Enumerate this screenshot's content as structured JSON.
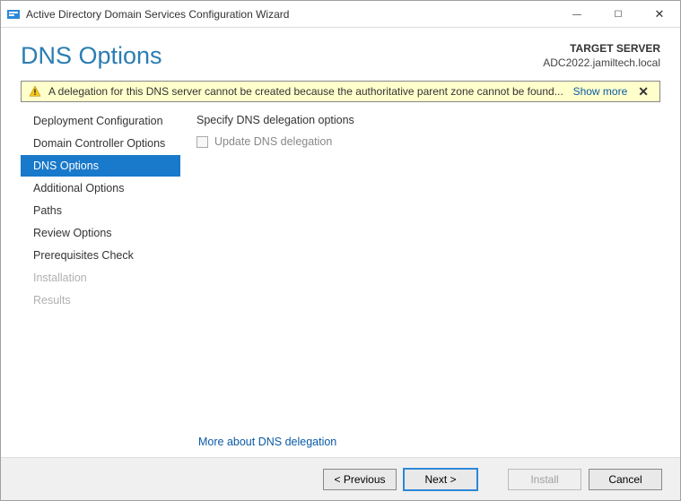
{
  "window": {
    "title": "Active Directory Domain Services Configuration Wizard"
  },
  "header": {
    "heading": "DNS Options",
    "target_label": "TARGET SERVER",
    "target_server": "ADC2022.jamiltech.local"
  },
  "warning": {
    "text": "A delegation for this DNS server cannot be created because the authoritative parent zone cannot be found...",
    "show_more": "Show more"
  },
  "sidebar": {
    "items": [
      {
        "label": "Deployment Configuration",
        "state": "normal"
      },
      {
        "label": "Domain Controller Options",
        "state": "normal"
      },
      {
        "label": "DNS Options",
        "state": "active"
      },
      {
        "label": "Additional Options",
        "state": "normal"
      },
      {
        "label": "Paths",
        "state": "normal"
      },
      {
        "label": "Review Options",
        "state": "normal"
      },
      {
        "label": "Prerequisites Check",
        "state": "normal"
      },
      {
        "label": "Installation",
        "state": "disabled"
      },
      {
        "label": "Results",
        "state": "disabled"
      }
    ]
  },
  "main": {
    "section_label": "Specify DNS delegation options",
    "checkbox_label": "Update DNS delegation",
    "checkbox_checked": false,
    "more_link": "More about DNS delegation"
  },
  "footer": {
    "previous": "< Previous",
    "next": "Next >",
    "install": "Install",
    "cancel": "Cancel"
  }
}
